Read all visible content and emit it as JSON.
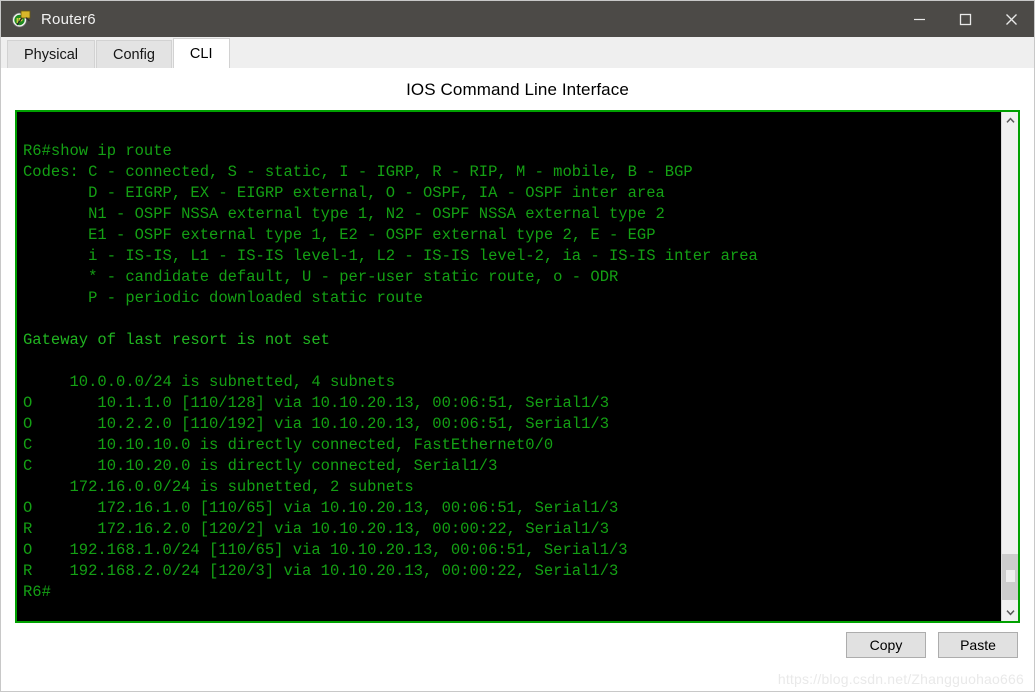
{
  "window": {
    "title": "Router6",
    "icon": "router-icon",
    "controls": {
      "minimize": "minimize-icon",
      "maximize": "maximize-icon",
      "close": "close-icon"
    }
  },
  "tabs": [
    {
      "label": "Physical",
      "selected": false
    },
    {
      "label": "Config",
      "selected": false
    },
    {
      "label": "CLI",
      "selected": true
    }
  ],
  "heading": "IOS Command Line Interface",
  "terminal": {
    "border_color": "#00a000",
    "background_color": "#000000",
    "text_color": "#14a014",
    "lines": [
      "",
      "R6#show ip route",
      "Codes: C - connected, S - static, I - IGRP, R - RIP, M - mobile, B - BGP",
      "       D - EIGRP, EX - EIGRP external, O - OSPF, IA - OSPF inter area",
      "       N1 - OSPF NSSA external type 1, N2 - OSPF NSSA external type 2",
      "       E1 - OSPF external type 1, E2 - OSPF external type 2, E - EGP",
      "       i - IS-IS, L1 - IS-IS level-1, L2 - IS-IS level-2, ia - IS-IS inter area",
      "       * - candidate default, U - per-user static route, o - ODR",
      "       P - periodic downloaded static route",
      "",
      "Gateway of last resort is not set",
      "",
      "     10.0.0.0/24 is subnetted, 4 subnets",
      "O       10.1.1.0 [110/128] via 10.10.20.13, 00:06:51, Serial1/3",
      "O       10.2.2.0 [110/192] via 10.10.20.13, 00:06:51, Serial1/3",
      "C       10.10.10.0 is directly connected, FastEthernet0/0",
      "C       10.10.20.0 is directly connected, Serial1/3",
      "     172.16.0.0/24 is subnetted, 2 subnets",
      "O       172.16.1.0 [110/65] via 10.10.20.13, 00:06:51, Serial1/3",
      "R       172.16.2.0 [120/2] via 10.10.20.13, 00:00:22, Serial1/3",
      "O    192.168.1.0/24 [110/65] via 10.10.20.13, 00:06:51, Serial1/3",
      "R    192.168.2.0/24 [120/3] via 10.10.20.13, 00:00:22, Serial1/3",
      "R6#"
    ],
    "prompt": "R6#",
    "command": "show ip route"
  },
  "routing_table": {
    "gateway_of_last_resort": "not set",
    "subnet_groups": [
      {
        "network": "10.0.0.0/24",
        "subnet_count": 4
      },
      {
        "network": "172.16.0.0/24",
        "subnet_count": 2
      }
    ],
    "routes": [
      {
        "code": "O",
        "network": "10.1.1.0",
        "metric": "[110/128]",
        "via": "10.10.20.13",
        "age": "00:06:51",
        "interface": "Serial1/3"
      },
      {
        "code": "O",
        "network": "10.2.2.0",
        "metric": "[110/192]",
        "via": "10.10.20.13",
        "age": "00:06:51",
        "interface": "Serial1/3"
      },
      {
        "code": "C",
        "network": "10.10.10.0",
        "metric": "",
        "via": "",
        "age": "",
        "interface": "FastEthernet0/0"
      },
      {
        "code": "C",
        "network": "10.10.20.0",
        "metric": "",
        "via": "",
        "age": "",
        "interface": "Serial1/3"
      },
      {
        "code": "O",
        "network": "172.16.1.0",
        "metric": "[110/65]",
        "via": "10.10.20.13",
        "age": "00:06:51",
        "interface": "Serial1/3"
      },
      {
        "code": "R",
        "network": "172.16.2.0",
        "metric": "[120/2]",
        "via": "10.10.20.13",
        "age": "00:00:22",
        "interface": "Serial1/3"
      },
      {
        "code": "O",
        "network": "192.168.1.0/24",
        "metric": "[110/65]",
        "via": "10.10.20.13",
        "age": "00:06:51",
        "interface": "Serial1/3"
      },
      {
        "code": "R",
        "network": "192.168.2.0/24",
        "metric": "[120/3]",
        "via": "10.10.20.13",
        "age": "00:00:22",
        "interface": "Serial1/3"
      }
    ]
  },
  "scrollbar": {
    "up_arrow": "chevron-up-icon",
    "down_arrow": "chevron-down-icon",
    "thumb_position": "bottom"
  },
  "buttons": {
    "copy": "Copy",
    "paste": "Paste"
  },
  "watermark": "https://blog.csdn.net/Zhangguohao666"
}
